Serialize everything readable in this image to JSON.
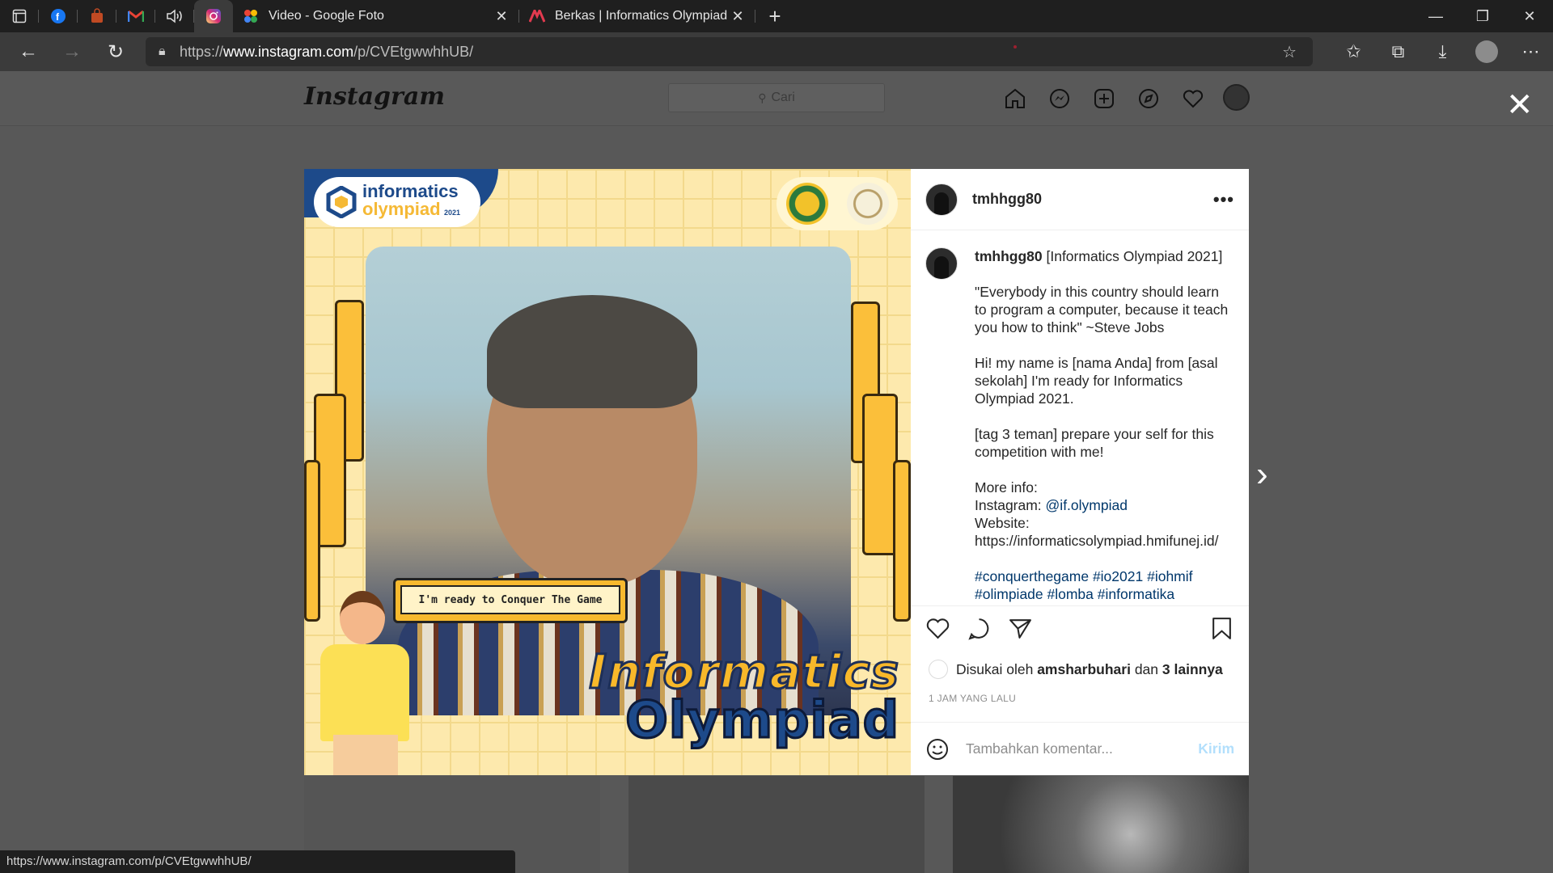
{
  "browser": {
    "tabs": [
      {
        "label": "Video - Google Foto"
      },
      {
        "label": "Berkas | Informatics Olympiad"
      }
    ],
    "url_scheme": "https://",
    "url_host": "www.instagram.com",
    "url_path": "/p/CVEtgwwhhUB/",
    "status_url": "https://www.instagram.com/p/CVEtgwwhhUB/"
  },
  "instagram": {
    "logo": "Instagram",
    "search_placeholder": "Cari"
  },
  "post": {
    "username": "tmhhgg80",
    "more": "•••",
    "caption": {
      "user": "tmhhgg80",
      "title": " [Informatics Olympiad 2021]",
      "quote": "\"Everybody in this country should learn to program a computer, because it teach you how to think\" ~Steve Jobs",
      "intro": "Hi! my name is [nama Anda] from [asal sekolah] I'm ready for Informatics Olympiad 2021.",
      "tag": "[tag 3 teman] prepare your self for this competition with me!",
      "more_info": "More info:",
      "instagram_label": "Instagram: ",
      "instagram_handle": "@if.olympiad",
      "website_label": "Website:",
      "website": "https://informaticsolympiad.hmifunej.id/",
      "hashtags_1": "#conquerthegame #io2021 #iohmif",
      "hashtags_2": "#olimpiade #lomba #informatika"
    },
    "likes": {
      "prefix": "Disukai oleh ",
      "user": "amsharbuhari",
      "middle": " dan ",
      "others": "3 lainnya"
    },
    "time": "1 JAM YANG LALU",
    "comment_placeholder": "Tambahkan komentar...",
    "post_button": "Kirim"
  },
  "image": {
    "brand_line1": "informatics",
    "brand_line2": "olympiad",
    "brand_year": "2021",
    "speech": "I'm ready to Conquer The Game",
    "title_line1": "Informatics",
    "title_line2": "Olympiad"
  },
  "colors": {
    "ig_link": "#00376b",
    "post_button": "#b2dffc",
    "io_blue": "#1d4a8a",
    "io_yellow": "#f8b82a"
  }
}
